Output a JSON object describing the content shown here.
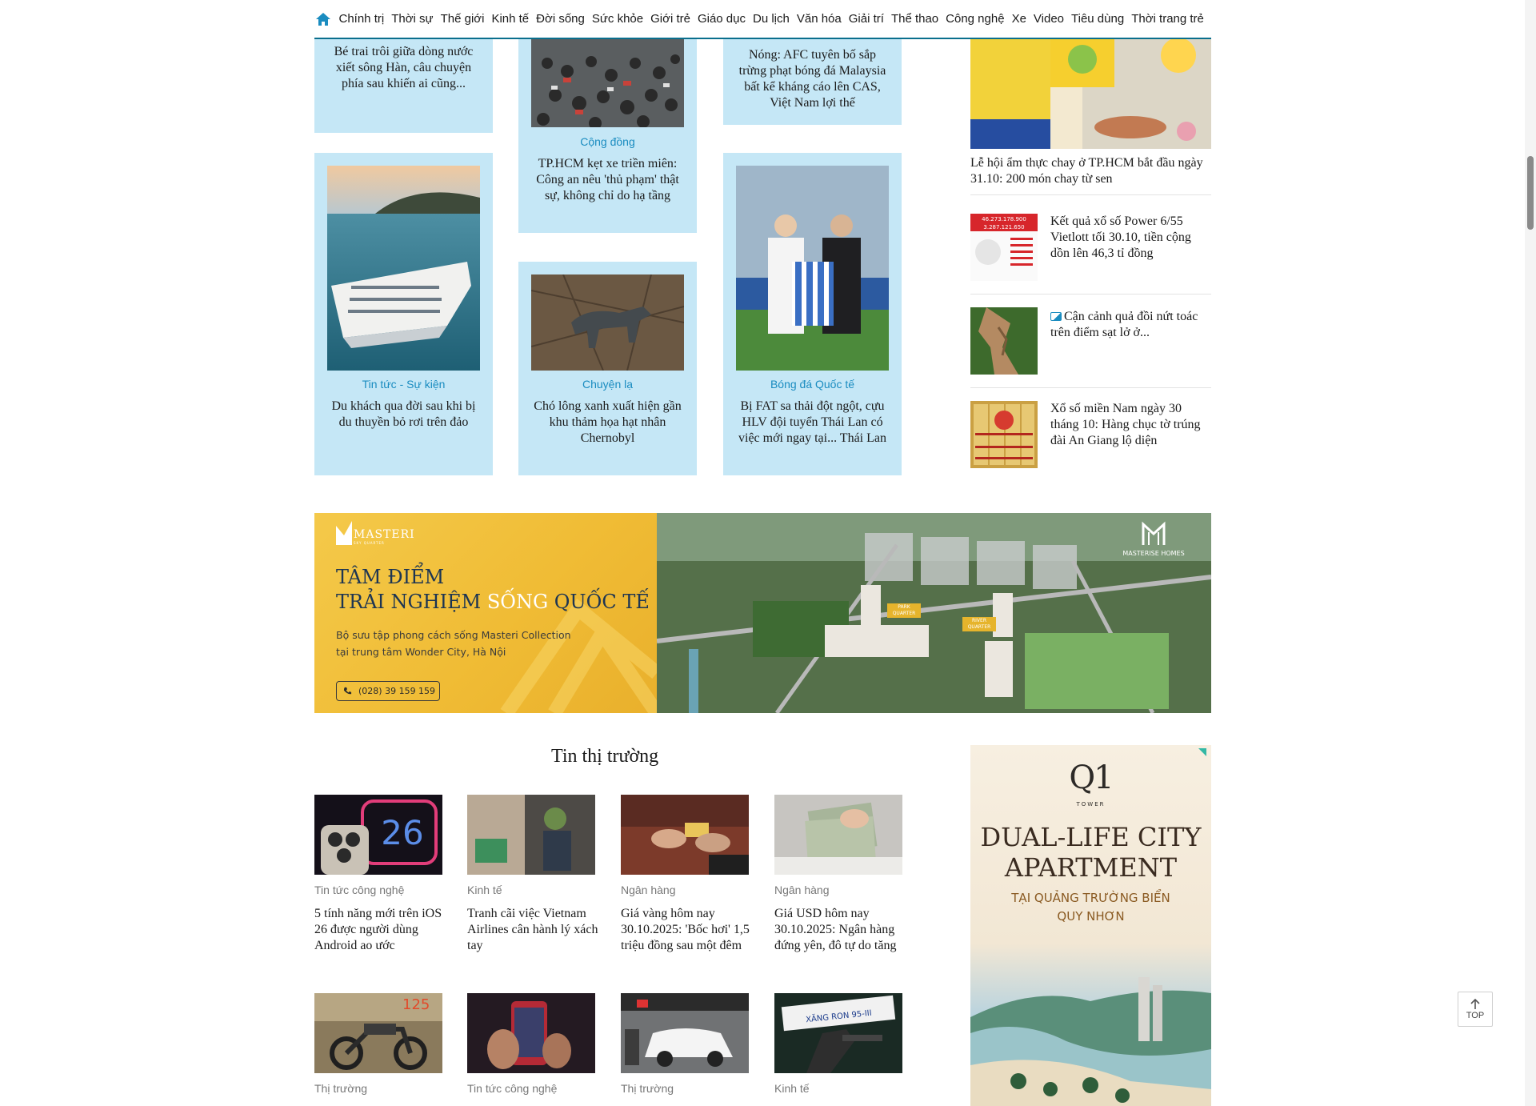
{
  "nav": {
    "items": [
      "Chính trị",
      "Thời sự",
      "Thế giới",
      "Kinh tế",
      "Đời sống",
      "Sức khỏe",
      "Giới trẻ",
      "Giáo dục",
      "Du lịch",
      "Văn hóa",
      "Giải trí",
      "Thể thao",
      "Công nghệ",
      "Xe",
      "Video",
      "Tiêu dùng",
      "Thời trang trẻ"
    ]
  },
  "cards": {
    "c1": {
      "title": "Bé trai trôi giữa dòng nước xiết sông Hàn, câu chuyện phía sau khiến ai cũng..."
    },
    "c2": {
      "category": "Cộng đồng",
      "title": "TP.HCM kẹt xe triền miên: Công an nêu 'thủ phạm' thật sự, không chỉ do hạ tầng"
    },
    "c3": {
      "title": "Nóng: AFC tuyên bố sắp trừng phạt bóng đá Malaysia bất kể kháng cáo lên CAS, Việt Nam lợi thế"
    },
    "c4": {
      "category": "Tin tức - Sự kiện",
      "title": "Du khách qua đời sau khi bị du thuyền bỏ rơi trên đảo"
    },
    "c5": {
      "category": "Chuyện lạ",
      "title": "Chó lông xanh xuất hiện gần khu thảm họa hạt nhân Chernobyl"
    },
    "c6": {
      "category": "Bóng đá Quốc tế",
      "title": "Bị FAT sa thải đột ngột, cựu HLV đội tuyển Thái Lan có việc mới ngay tại... Thái Lan"
    }
  },
  "right_list": {
    "feature_title": "Lễ hội ẩm thực chay ở TP.HCM bắt đầu ngày 31.10: 200 món chay từ sen",
    "items": [
      {
        "title": "Kết quả xổ số Power 6/55 Vietlott tối 30.10, tiền cộng dồn lên 46,3 tỉ đồng"
      },
      {
        "title": "Cận cảnh quả đồi nứt toác trên điểm sạt lở ở..."
      },
      {
        "title": "Xổ số miền Nam ngày 30 tháng 10: Hàng chục tờ trúng đài An Giang lộ diện"
      }
    ],
    "lottery_top_line": "46.273.178.900",
    "lottery_second_line": "3.287.121.650"
  },
  "banner": {
    "brand": "MASTERI",
    "brand_sub": "SKY QUARTER",
    "headline_1": "TÂM ĐIỂM",
    "headline_2a": "TRẢI NGHIỆM ",
    "headline_2b": "SỐNG ",
    "headline_2c": "QUỐC TẾ",
    "desc_1": "Bộ sưu tập phong cách sống Masteri Collection",
    "desc_2": "tại trung tâm Wonder City, Hà Nội",
    "phone": "(028) 39 159 159",
    "right_brand": "MASTERISE HOMES",
    "label_park": "PARK QUARTER",
    "label_river": "RIVER QUARTER"
  },
  "market": {
    "title": "Tin thị trường",
    "items": [
      {
        "category": "Tin tức công nghệ",
        "title": "5 tính năng mới trên iOS 26 được người dùng Android ao ước"
      },
      {
        "category": "Kinh tế",
        "title": "Tranh cãi việc Vietnam Airlines cân hành lý xách tay"
      },
      {
        "category": "Ngân hàng",
        "title": "Giá vàng hôm nay 30.10.2025: 'Bốc hơi' 1,5 triệu đồng sau một đêm"
      },
      {
        "category": "Ngân hàng",
        "title": "Giá USD hôm nay 30.10.2025: Ngân hàng đứng yên, đô tự do tăng"
      },
      {
        "category": "Thị trường",
        "title": ""
      },
      {
        "category": "Tin tức công nghệ",
        "title": ""
      },
      {
        "category": "Thị trường",
        "title": ""
      },
      {
        "category": "Kinh tế",
        "title": ""
      }
    ],
    "iphone_number": "26",
    "bike_number": "125",
    "fuel_text": "XĂNG RON 95-III"
  },
  "ad_right": {
    "logo": "Q1",
    "logo_sub": "TOWER",
    "line1": "DUAL-LIFE CITY",
    "line2": "APARTMENT",
    "line3": "TẠI QUẢNG TRƯỜNG BIỂN",
    "line4": "QUY NHƠN"
  },
  "top_button": {
    "label": "TOP"
  },
  "colors": {
    "accent": "#0a6f8d",
    "card_bg": "#c5e7f6",
    "category": "#1a8cc0"
  }
}
